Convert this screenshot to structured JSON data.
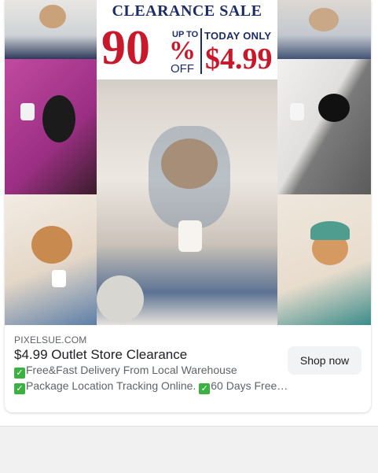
{
  "ad": {
    "creative": {
      "banner_title": "CLEARANCE SALE",
      "discount_number": "90",
      "up_to": "UP TO",
      "percent_sign": "%",
      "off": "OFF",
      "today_only": "TODAY ONLY",
      "price": "$4.99"
    },
    "domain": "PIXELSUE.COM",
    "headline": "$4.99 Outlet Store Clearance",
    "description_line1": "Free&Fast Delivery From Local Warehouse",
    "description_line2_a": "Package Location Tracking Online.",
    "description_line2_b": "60 Days Free…",
    "cta_label": "Shop now",
    "check_glyph": "✓"
  },
  "colors": {
    "sale_red": "#c8182c",
    "sale_navy": "#1d2c64",
    "check_green": "#3cb043"
  }
}
